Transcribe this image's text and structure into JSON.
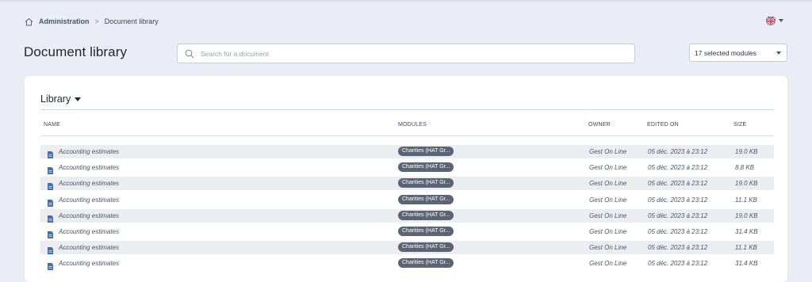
{
  "breadcrumb": {
    "home_icon": "home-icon",
    "parent": "Administration",
    "separator": ">",
    "current": "Document library"
  },
  "language": {
    "flag_icon": "uk-flag-icon"
  },
  "page": {
    "title": "Document library"
  },
  "search": {
    "placeholder": "Search for a document",
    "value": ""
  },
  "modules_select": {
    "selected": "17 selected modules"
  },
  "library": {
    "heading": "Library",
    "columns": {
      "name": "NAME",
      "modules": "MODULES",
      "owner": "OWNER",
      "edited_on": "EDITED ON",
      "size": "SIZE"
    },
    "rows": [
      {
        "name": "Accounting estimates",
        "module": "Charities (HAT Gr...",
        "owner": "Gest On Line",
        "edited_on": "05 déc. 2023 à 23:12",
        "size": "19.0 KB"
      },
      {
        "name": "Accounting estimates",
        "module": "Charities (HAT Gr...",
        "owner": "Gest On Line",
        "edited_on": "05 déc. 2023 à 23:12",
        "size": "8.8 KB"
      },
      {
        "name": "Accounting estimates",
        "module": "Charities (HAT Gr...",
        "owner": "Gest On Line",
        "edited_on": "05 déc. 2023 à 23:12",
        "size": "19.0 KB"
      },
      {
        "name": "Accounting estimates",
        "module": "Charities (HAT Gr...",
        "owner": "Gest On Line",
        "edited_on": "05 déc. 2023 à 23:12",
        "size": "11.1 KB"
      },
      {
        "name": "Accounting estimates",
        "module": "Charities (HAT Gr...",
        "owner": "Gest On Line",
        "edited_on": "05 déc. 2023 à 23:12",
        "size": "19.0 KB"
      },
      {
        "name": "Accounting estimates",
        "module": "Charities (HAT Gr...",
        "owner": "Gest On Line",
        "edited_on": "05 déc. 2023 à 23:12",
        "size": "31.4 KB"
      },
      {
        "name": "Accounting estimates",
        "module": "Charities (HAT Gr...",
        "owner": "Gest On Line",
        "edited_on": "05 déc. 2023 à 23:12",
        "size": "11.1 KB"
      },
      {
        "name": "Accounting estimates",
        "module": "Charities (HAT Gr...",
        "owner": "Gest On Line",
        "edited_on": "05 déc. 2023 à 23:12",
        "size": "31.4 KB"
      }
    ]
  },
  "colors": {
    "background": "#eaedf6",
    "badge": "#5b6474",
    "row_stripe": "#ebedf0",
    "file_icon": "#4a6ea8"
  }
}
